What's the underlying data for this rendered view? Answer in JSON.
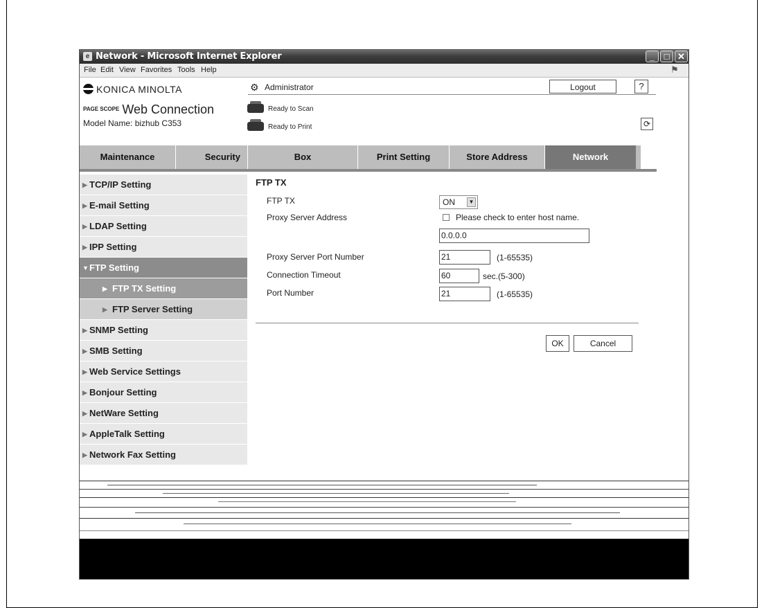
{
  "window": {
    "title": "Network - Microsoft Internet Explorer",
    "menu": [
      {
        "label": "File",
        "accel": "F"
      },
      {
        "label": "Edit",
        "accel": "E"
      },
      {
        "label": "View",
        "accel": "V"
      },
      {
        "label": "Favorites",
        "accel": "a"
      },
      {
        "label": "Tools",
        "accel": "T"
      },
      {
        "label": "Help",
        "accel": "H"
      }
    ]
  },
  "header": {
    "brand": "KONICA MINOLTA",
    "pagescope_small": "PAGE SCOPE",
    "product": "Web Connection",
    "model_label": "Model Name:",
    "model_value": "bizhub C353",
    "user": "Administrator",
    "logout_label": "Logout",
    "help_label": "?",
    "scan_status": "Ready to Scan",
    "print_status": "Ready to Print"
  },
  "tabs": [
    {
      "label": "Maintenance",
      "active": false
    },
    {
      "label": "Security",
      "active": false
    },
    {
      "label": "Box",
      "active": false
    },
    {
      "label": "Print Setting",
      "active": false
    },
    {
      "label": "Store Address",
      "active": false
    },
    {
      "label": "Network",
      "active": true
    }
  ],
  "sidebar": {
    "items": [
      {
        "label": "TCP/IP Setting"
      },
      {
        "label": "E-mail Setting"
      },
      {
        "label": "LDAP Setting"
      },
      {
        "label": "IPP Setting"
      },
      {
        "label": "FTP Setting"
      },
      {
        "label": "FTP TX Setting"
      },
      {
        "label": "FTP Server Setting"
      },
      {
        "label": "SNMP Setting"
      },
      {
        "label": "SMB Setting"
      },
      {
        "label": "Web Service Settings"
      },
      {
        "label": "Bonjour Setting"
      },
      {
        "label": "NetWare Setting"
      },
      {
        "label": "AppleTalk Setting"
      },
      {
        "label": "Network Fax Setting"
      }
    ]
  },
  "form": {
    "section_title": "FTP TX",
    "ftp_tx_label": "FTP TX",
    "ftp_tx_value": "ON",
    "proxy_address_label": "Proxy Server Address",
    "proxy_hostname_checkbox": "Please check to enter host name.",
    "proxy_address_value": "0.0.0.0",
    "proxy_port_label": "Proxy Server Port Number",
    "proxy_port_value": "21",
    "proxy_port_hint": "(1-65535)",
    "timeout_label": "Connection Timeout",
    "timeout_value": "60",
    "timeout_hint": "sec.(5-300)",
    "port_label": "Port Number",
    "port_value": "21",
    "port_hint": "(1-65535)",
    "ok_label": "OK",
    "cancel_label": "Cancel"
  }
}
